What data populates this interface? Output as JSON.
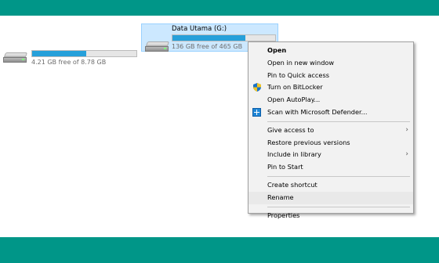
{
  "drives": [
    {
      "name": "",
      "free_text": "4.21 GB free of 8.78 GB",
      "used_fraction": 0.52,
      "selected": false
    },
    {
      "name": "Data Utama (G:)",
      "free_text": "136 GB free of 465 GB",
      "used_fraction": 0.71,
      "selected": true
    }
  ],
  "context_menu": {
    "items": [
      {
        "label": "Open",
        "bold": true,
        "icon": "",
        "submenu": false
      },
      {
        "label": "Open in new window",
        "bold": false,
        "icon": "",
        "submenu": false
      },
      {
        "label": "Pin to Quick access",
        "bold": false,
        "icon": "",
        "submenu": false
      },
      {
        "label": "Turn on BitLocker",
        "bold": false,
        "icon": "shield-icon",
        "submenu": false
      },
      {
        "label": "Open AutoPlay...",
        "bold": false,
        "icon": "",
        "submenu": false
      },
      {
        "label": "Scan with Microsoft Defender...",
        "bold": false,
        "icon": "defender-icon",
        "submenu": false
      },
      {
        "label": "Give access to",
        "bold": false,
        "icon": "",
        "submenu": true
      },
      {
        "label": "Restore previous versions",
        "bold": false,
        "icon": "",
        "submenu": false
      },
      {
        "label": "Include in library",
        "bold": false,
        "icon": "",
        "submenu": true
      },
      {
        "label": "Pin to Start",
        "bold": false,
        "icon": "",
        "submenu": false
      },
      {
        "label": "Create shortcut",
        "bold": false,
        "icon": "",
        "submenu": false
      },
      {
        "label": "Rename",
        "bold": false,
        "icon": "",
        "submenu": false,
        "highlighted": true
      },
      {
        "label": "Properties",
        "bold": false,
        "icon": "",
        "submenu": false
      }
    ]
  },
  "colors": {
    "background": "#009688",
    "bar_fill": "#26a0da",
    "selection": "#cce8ff"
  }
}
